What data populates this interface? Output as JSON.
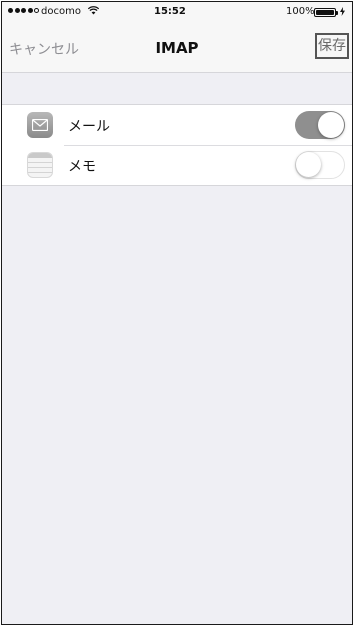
{
  "status_bar": {
    "carrier": "docomo",
    "time": "15:52",
    "battery_percent": "100%",
    "signal_bars_filled": 4,
    "signal_bars_total": 5,
    "icons": [
      "signal-dots-icon",
      "wifi-icon",
      "battery-icon",
      "charging-icon"
    ]
  },
  "nav": {
    "cancel_label": "キャンセル",
    "title": "IMAP",
    "save_label": "保存"
  },
  "services": [
    {
      "label": "メール",
      "icon": "mail-icon",
      "enabled": true
    },
    {
      "label": "メモ",
      "icon": "notes-icon",
      "enabled": false
    }
  ],
  "colors": {
    "toggle_on": "#8f8f8f",
    "background": "#efeff4",
    "nav_background": "#f7f7f7"
  }
}
